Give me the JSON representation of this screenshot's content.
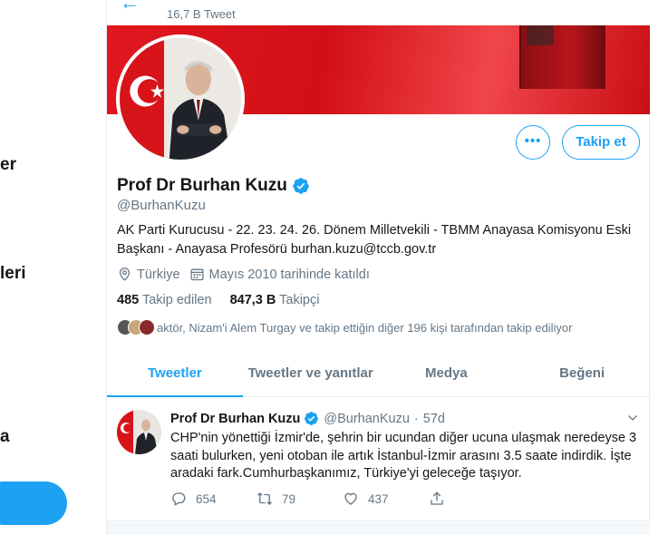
{
  "leftnav": {
    "frag1": "er",
    "frag2": "leri",
    "frag3": "a"
  },
  "header": {
    "tweet_count": "16,7 B Tweet"
  },
  "profile": {
    "name": "Prof Dr Burhan Kuzu",
    "handle": "@BurhanKuzu",
    "bio": "AK Parti Kurucusu - 22. 23. 24. 26. Dönem Milletvekili - TBMM Anayasa Komisyonu Eski Başkanı - Anayasa Profesörü burhan.kuzu@tccb.gov.tr",
    "location": "Türkiye",
    "joined": "Mayıs 2010 tarihinde katıldı",
    "following_count": "485",
    "following_label": "Takip edilen",
    "followers_count": "847,3 B",
    "followers_label": "Takipçi",
    "followed_by": "aktör, Nizam'i Alem Turgay ve takip ettiğin diğer 196 kişi tarafından takip ediliyor",
    "follow_button": "Takip et",
    "more_icon": "more-horizontal-icon"
  },
  "tabs": [
    {
      "label": "Tweetler",
      "active": true
    },
    {
      "label": "Tweetler ve yanıtlar",
      "active": false
    },
    {
      "label": "Medya",
      "active": false
    },
    {
      "label": "Beğeni",
      "active": false
    }
  ],
  "tweet": {
    "name": "Prof Dr Burhan Kuzu",
    "handle": "@BurhanKuzu",
    "separator": "·",
    "time": "57d",
    "text": "CHP'nin yönettiği İzmir'de, şehrin bir ucundan diğer ucuna ulaşmak neredeyse 3 saati bulurken, yeni otoban ile artık İstanbul-İzmir arasını 3.5 saate indirdik. İşte aradaki fark.Cumhurbaşkanımız, Türkiye'yi geleceğe taşıyor.",
    "replies": "654",
    "retweets": "79",
    "likes": "437"
  },
  "colors": {
    "accent": "#1da1f2",
    "secondary_text": "#657786",
    "banner_red": "#e1171f"
  }
}
